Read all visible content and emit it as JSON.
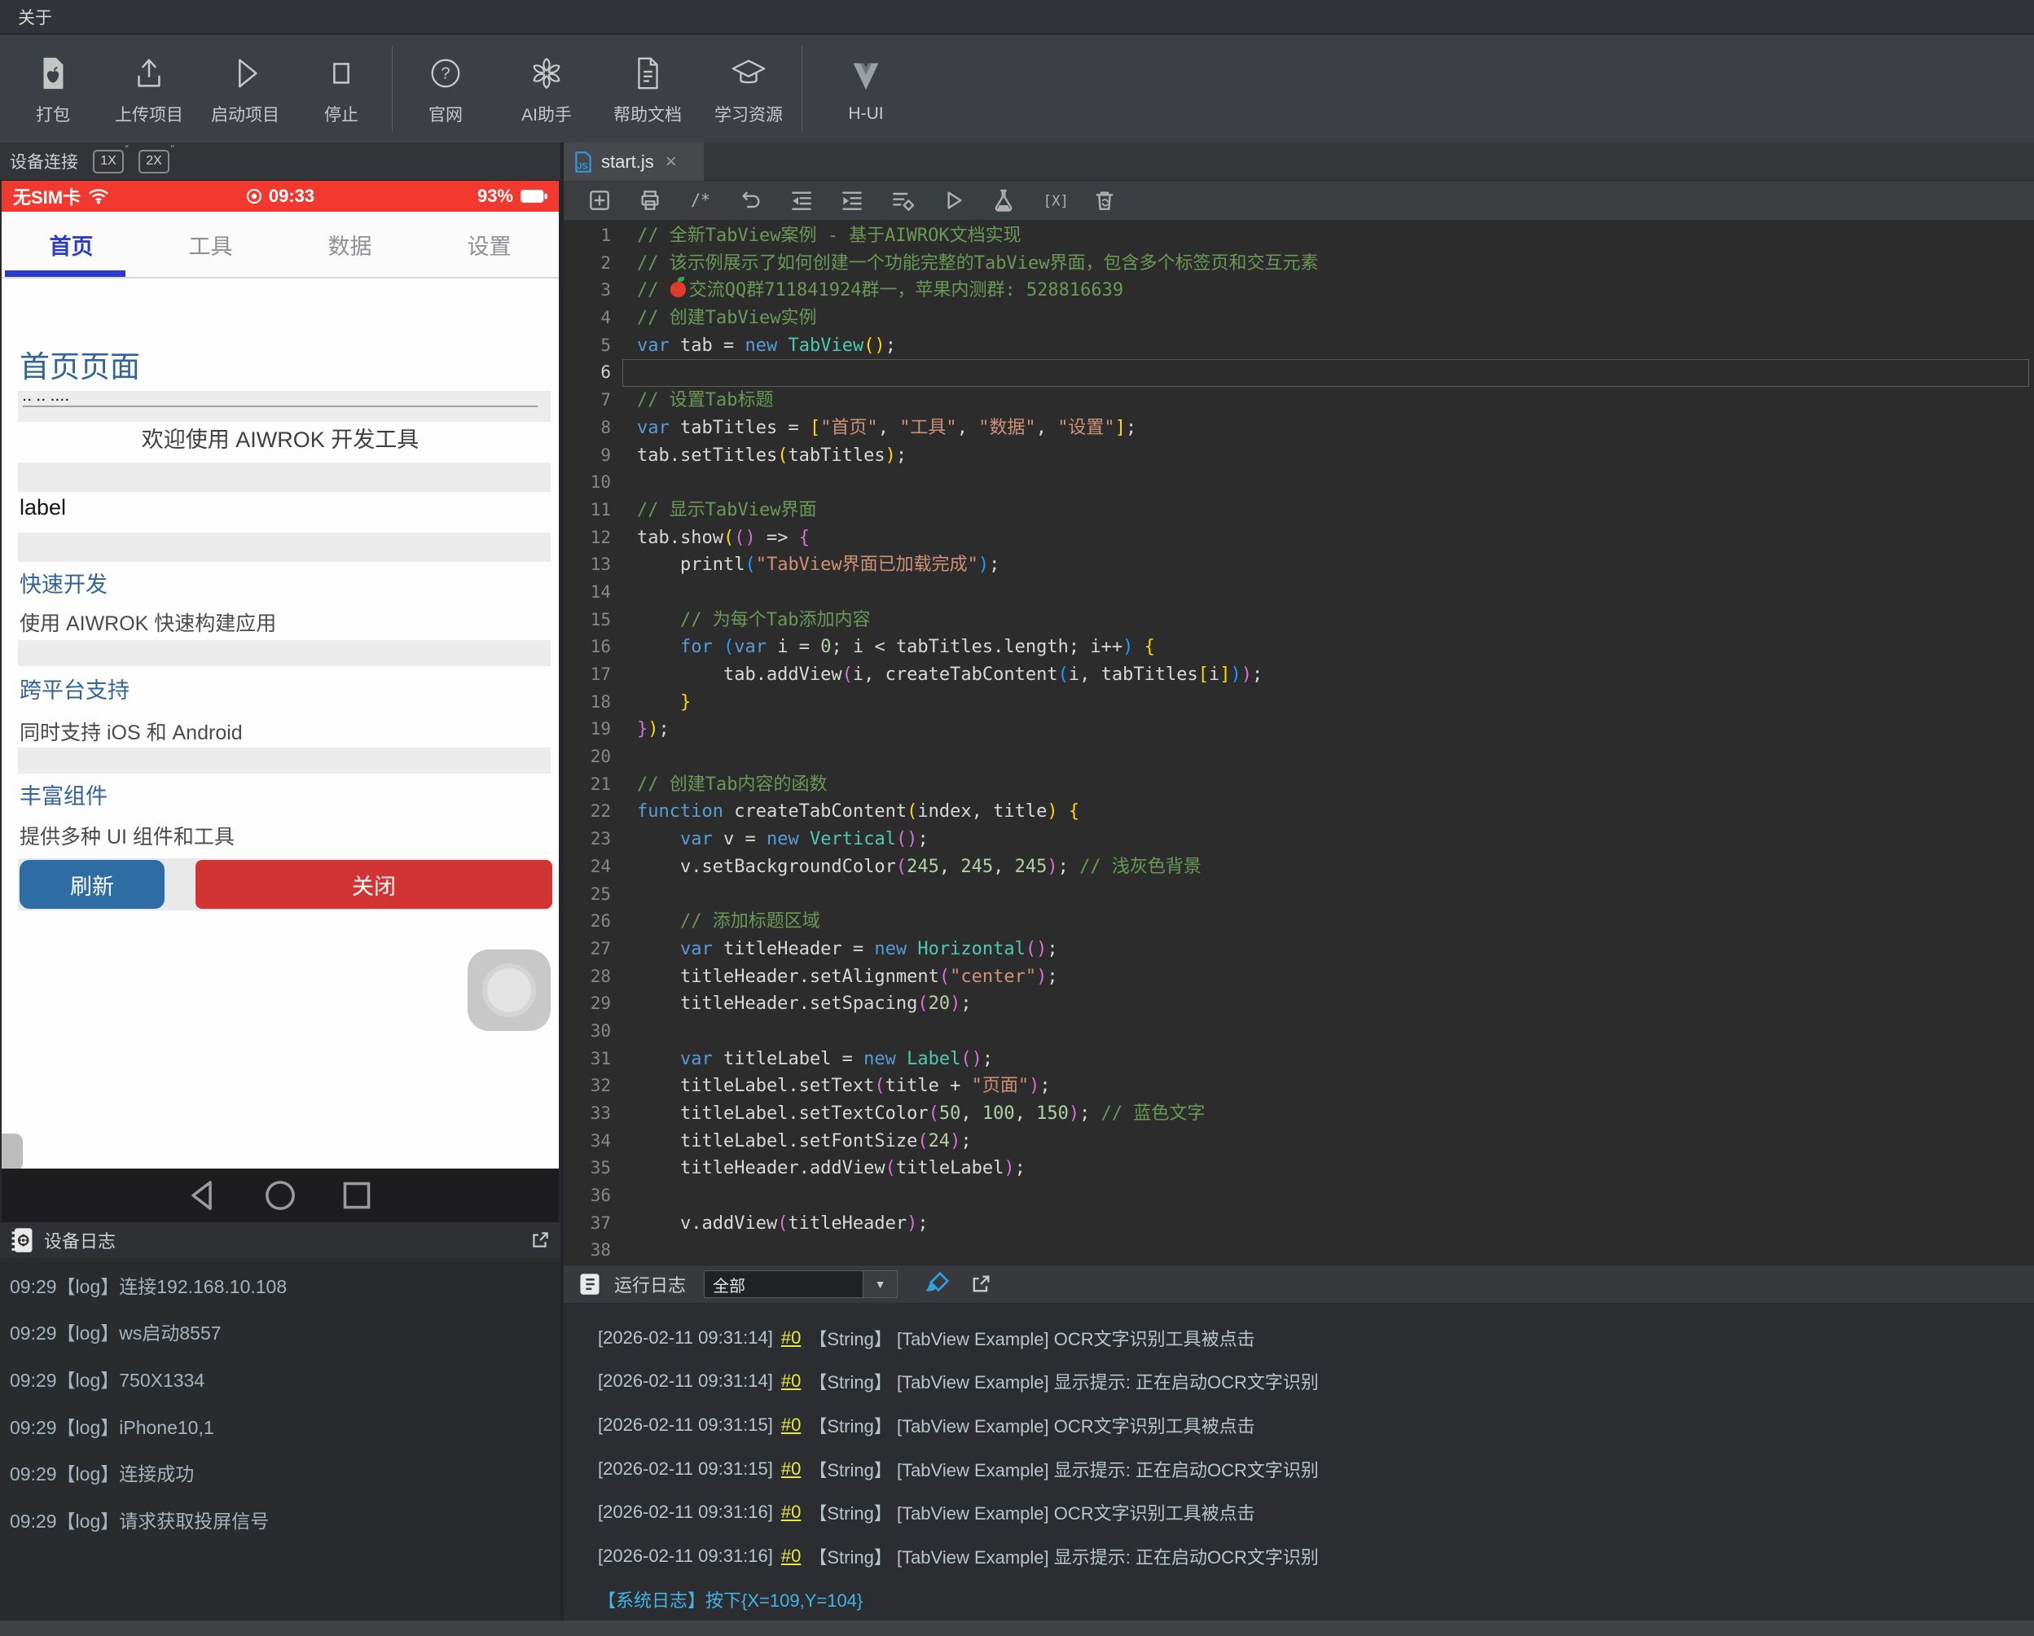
{
  "menu": {
    "about": "关于"
  },
  "toolbar": {
    "buttons": [
      {
        "name": "package",
        "label": "打包",
        "w": 118
      },
      {
        "name": "upload",
        "label": "上传项目",
        "w": 118
      },
      {
        "name": "run",
        "label": "启动项目",
        "w": 118
      },
      {
        "name": "stop",
        "label": "停止",
        "w": 118,
        "sep_after": true
      },
      {
        "name": "website",
        "label": "官网",
        "w": 124
      },
      {
        "name": "ai",
        "label": "AI助手",
        "w": 124
      },
      {
        "name": "docs",
        "label": "帮助文档",
        "w": 124
      },
      {
        "name": "learn",
        "label": "学习资源",
        "w": 124,
        "sep_after": true
      },
      {
        "name": "hui",
        "label": "H-UI",
        "w": 150
      }
    ]
  },
  "device": {
    "header": "设备连接",
    "zoom_1x": "1X",
    "zoom_2x": "2X",
    "status": {
      "carrier": "无SIM卡",
      "time": "09:33",
      "battery": "93%"
    },
    "tabs": [
      {
        "label": "首页",
        "active": true
      },
      {
        "label": "工具",
        "active": false
      },
      {
        "label": "数据",
        "active": false
      },
      {
        "label": "设置",
        "active": false
      }
    ],
    "page": {
      "title": "首页页面",
      "divider_marks": "·· ·· ····",
      "welcome": "欢迎使用 AIWROK 开发工具",
      "label": "label",
      "sections": [
        {
          "heading": "快速开发",
          "desc": "使用 AIWROK 快速构建应用"
        },
        {
          "heading": "跨平台支持",
          "desc": "同时支持 iOS 和 Android"
        },
        {
          "heading": "丰富组件",
          "desc": "提供多种 UI 组件和工具"
        }
      ],
      "refresh_button": "刷新",
      "close_button": "关闭"
    },
    "log": {
      "title": "设备日志",
      "entries": [
        "09:29【log】连接192.168.10.108",
        "09:29【log】ws启动8557",
        "09:29【log】750X1334",
        "09:29【log】iPhone10,1",
        "09:29【log】连接成功",
        "09:29【log】请求获取投屏信号"
      ]
    }
  },
  "editor": {
    "tab": "start.js",
    "toolbar_icons": [
      "new-file",
      "print",
      "comment",
      "undo",
      "outdent",
      "indent",
      "format",
      "run",
      "test",
      "variable",
      "clean"
    ],
    "lines": [
      {
        "n": 1,
        "t": [
          [
            "c",
            "// 全新TabView案例 - 基于AIWROK文档实现"
          ]
        ]
      },
      {
        "n": 2,
        "t": [
          [
            "c",
            "// 该示例展示了如何创建一个功能完整的TabView界面，包含多个标签页和交互元素"
          ]
        ]
      },
      {
        "n": 3,
        "t": [
          [
            "c",
            "// "
          ],
          [
            "a",
            ""
          ],
          [
            "c",
            "交流QQ群711841924群一，苹果内测群: 528816639"
          ]
        ]
      },
      {
        "n": 4,
        "t": [
          [
            "c",
            "// 创建TabView实例"
          ]
        ]
      },
      {
        "n": 5,
        "t": [
          [
            "k",
            "var"
          ],
          [
            "d",
            " tab = "
          ],
          [
            "k",
            "new"
          ],
          [
            "d",
            " "
          ],
          [
            "t",
            "TabView"
          ],
          [
            "b1",
            "()"
          ],
          [
            "d",
            ";"
          ]
        ]
      },
      {
        "n": 6,
        "cur": true,
        "t": []
      },
      {
        "n": 7,
        "t": [
          [
            "c",
            "// 设置Tab标题"
          ]
        ]
      },
      {
        "n": 8,
        "t": [
          [
            "k",
            "var"
          ],
          [
            "d",
            " tabTitles = "
          ],
          [
            "b1",
            "["
          ],
          [
            "s",
            "\"首页\""
          ],
          [
            "d",
            ", "
          ],
          [
            "s",
            "\"工具\""
          ],
          [
            "d",
            ", "
          ],
          [
            "s",
            "\"数据\""
          ],
          [
            "d",
            ", "
          ],
          [
            "s",
            "\"设置\""
          ],
          [
            "b1",
            "]"
          ],
          [
            "d",
            ";"
          ]
        ]
      },
      {
        "n": 9,
        "t": [
          [
            "d",
            "tab.setTitles"
          ],
          [
            "b1",
            "("
          ],
          [
            "d",
            "tabTitles"
          ],
          [
            "b1",
            ")"
          ],
          [
            "d",
            ";"
          ]
        ]
      },
      {
        "n": 10,
        "t": []
      },
      {
        "n": 11,
        "t": [
          [
            "c",
            "// 显示TabView界面"
          ]
        ]
      },
      {
        "n": 12,
        "t": [
          [
            "d",
            "tab.show"
          ],
          [
            "b1",
            "("
          ],
          [
            "b2",
            "()"
          ],
          [
            "d",
            " => "
          ],
          [
            "b2",
            "{"
          ]
        ]
      },
      {
        "n": 13,
        "t": [
          [
            "d",
            "    printl"
          ],
          [
            "b3",
            "("
          ],
          [
            "s",
            "\"TabView界面已加载完成\""
          ],
          [
            "b3",
            ")"
          ],
          [
            "d",
            ";"
          ]
        ]
      },
      {
        "n": 14,
        "t": []
      },
      {
        "n": 15,
        "t": [
          [
            "c",
            "    // 为每个Tab添加内容"
          ]
        ]
      },
      {
        "n": 16,
        "t": [
          [
            "d",
            "    "
          ],
          [
            "k",
            "for"
          ],
          [
            "d",
            " "
          ],
          [
            "b3",
            "("
          ],
          [
            "k",
            "var"
          ],
          [
            "d",
            " i = "
          ],
          [
            "n2",
            "0"
          ],
          [
            "d",
            "; i < tabTitles.length; i++"
          ],
          [
            "b3",
            ")"
          ],
          [
            "d",
            " "
          ],
          [
            "b1",
            "{"
          ]
        ]
      },
      {
        "n": 17,
        "t": [
          [
            "d",
            "        tab.addView"
          ],
          [
            "b2",
            "("
          ],
          [
            "d",
            "i, createTabContent"
          ],
          [
            "b3",
            "("
          ],
          [
            "d",
            "i, tabTitles"
          ],
          [
            "b1",
            "["
          ],
          [
            "d",
            "i"
          ],
          [
            "b1",
            "]"
          ],
          [
            "b3",
            ")"
          ],
          [
            "b2",
            ")"
          ],
          [
            "d",
            ";"
          ]
        ]
      },
      {
        "n": 18,
        "t": [
          [
            "d",
            "    "
          ],
          [
            "b1",
            "}"
          ]
        ]
      },
      {
        "n": 19,
        "t": [
          [
            "b2",
            "}"
          ],
          [
            "b1",
            ")"
          ],
          [
            "d",
            ";"
          ]
        ]
      },
      {
        "n": 20,
        "t": []
      },
      {
        "n": 21,
        "t": [
          [
            "c",
            "// 创建Tab内容的函数"
          ]
        ]
      },
      {
        "n": 22,
        "t": [
          [
            "k",
            "function"
          ],
          [
            "d",
            " createTabContent"
          ],
          [
            "b1",
            "("
          ],
          [
            "d",
            "index, title"
          ],
          [
            "b1",
            ")"
          ],
          [
            "d",
            " "
          ],
          [
            "b1",
            "{"
          ]
        ]
      },
      {
        "n": 23,
        "t": [
          [
            "d",
            "    "
          ],
          [
            "k",
            "var"
          ],
          [
            "d",
            " v = "
          ],
          [
            "k",
            "new"
          ],
          [
            "d",
            " "
          ],
          [
            "t",
            "Vertical"
          ],
          [
            "b2",
            "()"
          ],
          [
            "d",
            ";"
          ]
        ]
      },
      {
        "n": 24,
        "t": [
          [
            "d",
            "    v.setBackgroundColor"
          ],
          [
            "b2",
            "("
          ],
          [
            "n2",
            "245"
          ],
          [
            "d",
            ", "
          ],
          [
            "n2",
            "245"
          ],
          [
            "d",
            ", "
          ],
          [
            "n2",
            "245"
          ],
          [
            "b2",
            ")"
          ],
          [
            "d",
            "; "
          ],
          [
            "c",
            "// 浅灰色背景"
          ]
        ]
      },
      {
        "n": 25,
        "t": []
      },
      {
        "n": 26,
        "t": [
          [
            "c",
            "    // 添加标题区域"
          ]
        ]
      },
      {
        "n": 27,
        "t": [
          [
            "d",
            "    "
          ],
          [
            "k",
            "var"
          ],
          [
            "d",
            " titleHeader = "
          ],
          [
            "k",
            "new"
          ],
          [
            "d",
            " "
          ],
          [
            "t",
            "Horizontal"
          ],
          [
            "b2",
            "()"
          ],
          [
            "d",
            ";"
          ]
        ]
      },
      {
        "n": 28,
        "t": [
          [
            "d",
            "    titleHeader.setAlignment"
          ],
          [
            "b2",
            "("
          ],
          [
            "s",
            "\"center\""
          ],
          [
            "b2",
            ")"
          ],
          [
            "d",
            ";"
          ]
        ]
      },
      {
        "n": 29,
        "t": [
          [
            "d",
            "    titleHeader.setSpacing"
          ],
          [
            "b2",
            "("
          ],
          [
            "n2",
            "20"
          ],
          [
            "b2",
            ")"
          ],
          [
            "d",
            ";"
          ]
        ]
      },
      {
        "n": 30,
        "t": []
      },
      {
        "n": 31,
        "t": [
          [
            "d",
            "    "
          ],
          [
            "k",
            "var"
          ],
          [
            "d",
            " titleLabel = "
          ],
          [
            "k",
            "new"
          ],
          [
            "d",
            " "
          ],
          [
            "t",
            "Label"
          ],
          [
            "b2",
            "()"
          ],
          [
            "d",
            ";"
          ]
        ]
      },
      {
        "n": 32,
        "t": [
          [
            "d",
            "    titleLabel.setText"
          ],
          [
            "b2",
            "("
          ],
          [
            "d",
            "title + "
          ],
          [
            "s",
            "\"页面\""
          ],
          [
            "b2",
            ")"
          ],
          [
            "d",
            ";"
          ]
        ]
      },
      {
        "n": 33,
        "t": [
          [
            "d",
            "    titleLabel.setTextColor"
          ],
          [
            "b2",
            "("
          ],
          [
            "n2",
            "50"
          ],
          [
            "d",
            ", "
          ],
          [
            "n2",
            "100"
          ],
          [
            "d",
            ", "
          ],
          [
            "n2",
            "150"
          ],
          [
            "b2",
            ")"
          ],
          [
            "d",
            "; "
          ],
          [
            "c",
            "// 蓝色文字"
          ]
        ]
      },
      {
        "n": 34,
        "t": [
          [
            "d",
            "    titleLabel.setFontSize"
          ],
          [
            "b2",
            "("
          ],
          [
            "n2",
            "24"
          ],
          [
            "b2",
            ")"
          ],
          [
            "d",
            ";"
          ]
        ]
      },
      {
        "n": 35,
        "t": [
          [
            "d",
            "    titleHeader.addView"
          ],
          [
            "b2",
            "("
          ],
          [
            "d",
            "titleLabel"
          ],
          [
            "b2",
            ")"
          ],
          [
            "d",
            ";"
          ]
        ]
      },
      {
        "n": 36,
        "t": []
      },
      {
        "n": 37,
        "t": [
          [
            "d",
            "    v.addView"
          ],
          [
            "b2",
            "("
          ],
          [
            "d",
            "titleHeader"
          ],
          [
            "b2",
            ")"
          ],
          [
            "d",
            ";"
          ]
        ]
      },
      {
        "n": 38,
        "t": []
      }
    ]
  },
  "runlog": {
    "title": "运行日志",
    "filter": "全部",
    "entries": [
      {
        "time": "[2026-02-11 09:31:14]",
        "ref": "#0",
        "type": "【String】",
        "msg": "[TabView Example] OCR文字识别工具被点击"
      },
      {
        "time": "[2026-02-11 09:31:14]",
        "ref": "#0",
        "type": "【String】",
        "msg": "[TabView Example] 显示提示: 正在启动OCR文字识别"
      },
      {
        "time": "[2026-02-11 09:31:15]",
        "ref": "#0",
        "type": "【String】",
        "msg": "[TabView Example] OCR文字识别工具被点击"
      },
      {
        "time": "[2026-02-11 09:31:15]",
        "ref": "#0",
        "type": "【String】",
        "msg": "[TabView Example] 显示提示: 正在启动OCR文字识别"
      },
      {
        "time": "[2026-02-11 09:31:16]",
        "ref": "#0",
        "type": "【String】",
        "msg": "[TabView Example] OCR文字识别工具被点击"
      },
      {
        "time": "[2026-02-11 09:31:16]",
        "ref": "#0",
        "type": "【String】",
        "msg": "[TabView Example] 显示提示: 正在启动OCR文字识别"
      }
    ],
    "system_entry": "【系统日志】按下{X=109,Y=104}"
  },
  "colors": {
    "status_red": "#f2392f",
    "tab_blue": "#2c3cc8",
    "heading_blue": "#326496",
    "refresh_blue": "#2e6da4",
    "close_red": "#d23434",
    "log_ref_yellow": "#e6e93e",
    "system_log_cyan": "#41b5e8",
    "comment_green": "#6a9955",
    "keyword_blue": "#569cd6",
    "class_teal": "#4ec9b0",
    "string_salmon": "#ce9178"
  }
}
